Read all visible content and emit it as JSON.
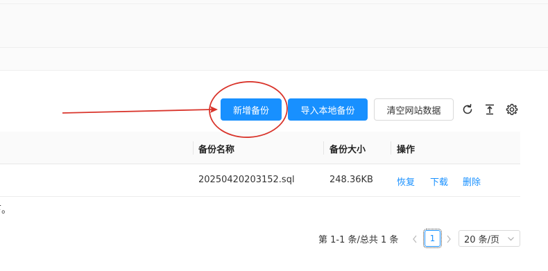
{
  "toolbar": {
    "add_backup_label": "新增备份",
    "import_local_label": "导入本地备份",
    "clear_site_label": "清空网站数据",
    "refresh_icon": "refresh-icon",
    "upload_icon": "upload-icon",
    "settings_icon": "gear-icon"
  },
  "table": {
    "columns": [
      "备份名称",
      "备份大小",
      "操作"
    ],
    "rows": [
      {
        "name": "20250420203152.sql",
        "size": "248.36KB",
        "actions": [
          "恢复",
          "下载",
          "删除"
        ]
      }
    ]
  },
  "fragment_text": "下。",
  "pagination": {
    "total_text": "第 1-1 条/总共 1 条",
    "current_page": "1",
    "page_size": "20 条/页"
  },
  "colors": {
    "primary": "#1890ff",
    "annotation": "#d9342b"
  }
}
